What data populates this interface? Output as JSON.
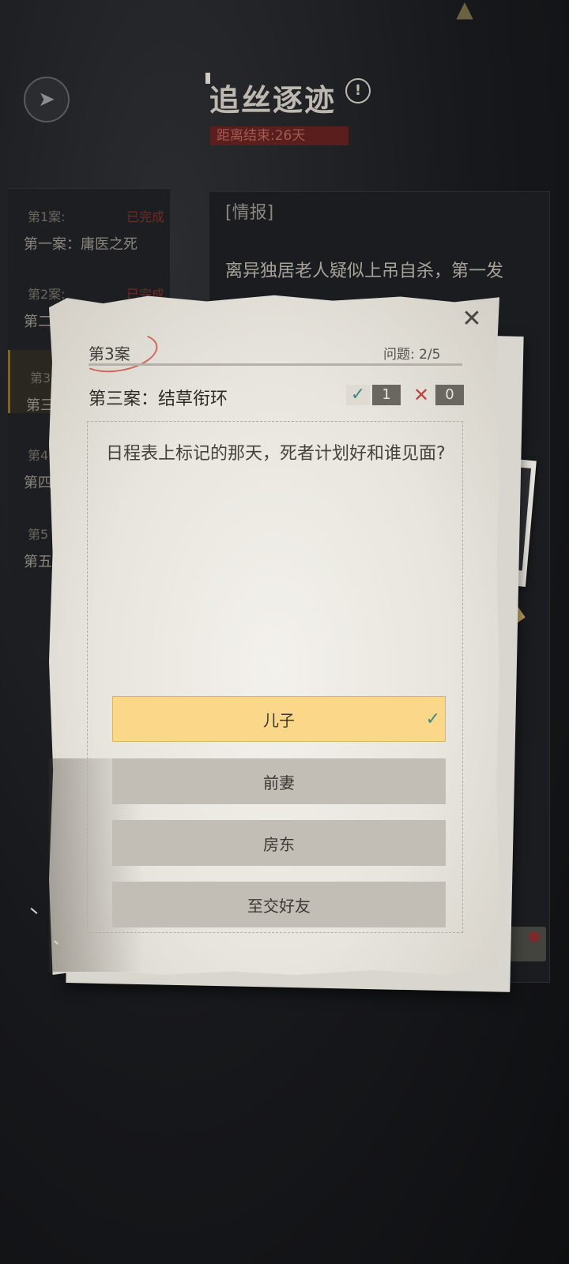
{
  "header": {
    "title": "追丝逐迹",
    "countdown": "距离结束:26天"
  },
  "sidebar": {
    "cases": [
      {
        "num": "第1案:",
        "status": "已完成",
        "name": "第一案：庸医之死"
      },
      {
        "num": "第2案:",
        "status": "已完成",
        "name": "第二"
      },
      {
        "num": "第3",
        "status": "",
        "name": "第三"
      },
      {
        "num": "第4",
        "status": "",
        "name": "第四"
      },
      {
        "num": "第5",
        "status": "",
        "name": "第五"
      }
    ]
  },
  "intel": {
    "title": "[情报]",
    "text": "离异独居老人疑似上吊自杀，第一发"
  },
  "dialog": {
    "case_label": "第3案",
    "question_count": "问题: 2/5",
    "case_name": "第三案：结草衔环",
    "correct_count": "1",
    "wrong_count": "0",
    "question": "日程表上标记的那天，死者计划好和谁见面?",
    "options": [
      {
        "label": "儿子",
        "state": "correct"
      },
      {
        "label": "前妻",
        "state": "normal"
      },
      {
        "label": "房东",
        "state": "normal"
      },
      {
        "label": "至交好友",
        "state": "normal"
      }
    ]
  },
  "colors": {
    "correct_option": "#fbd78a",
    "correct_check": "#3a8c84",
    "wrong_mark": "#b8443c",
    "countdown_bg": "#5a1f1c"
  },
  "icons": {
    "back": "back-arrow-icon",
    "info": "info-icon",
    "close": "close-icon",
    "check": "check-icon",
    "cross": "cross-icon"
  }
}
